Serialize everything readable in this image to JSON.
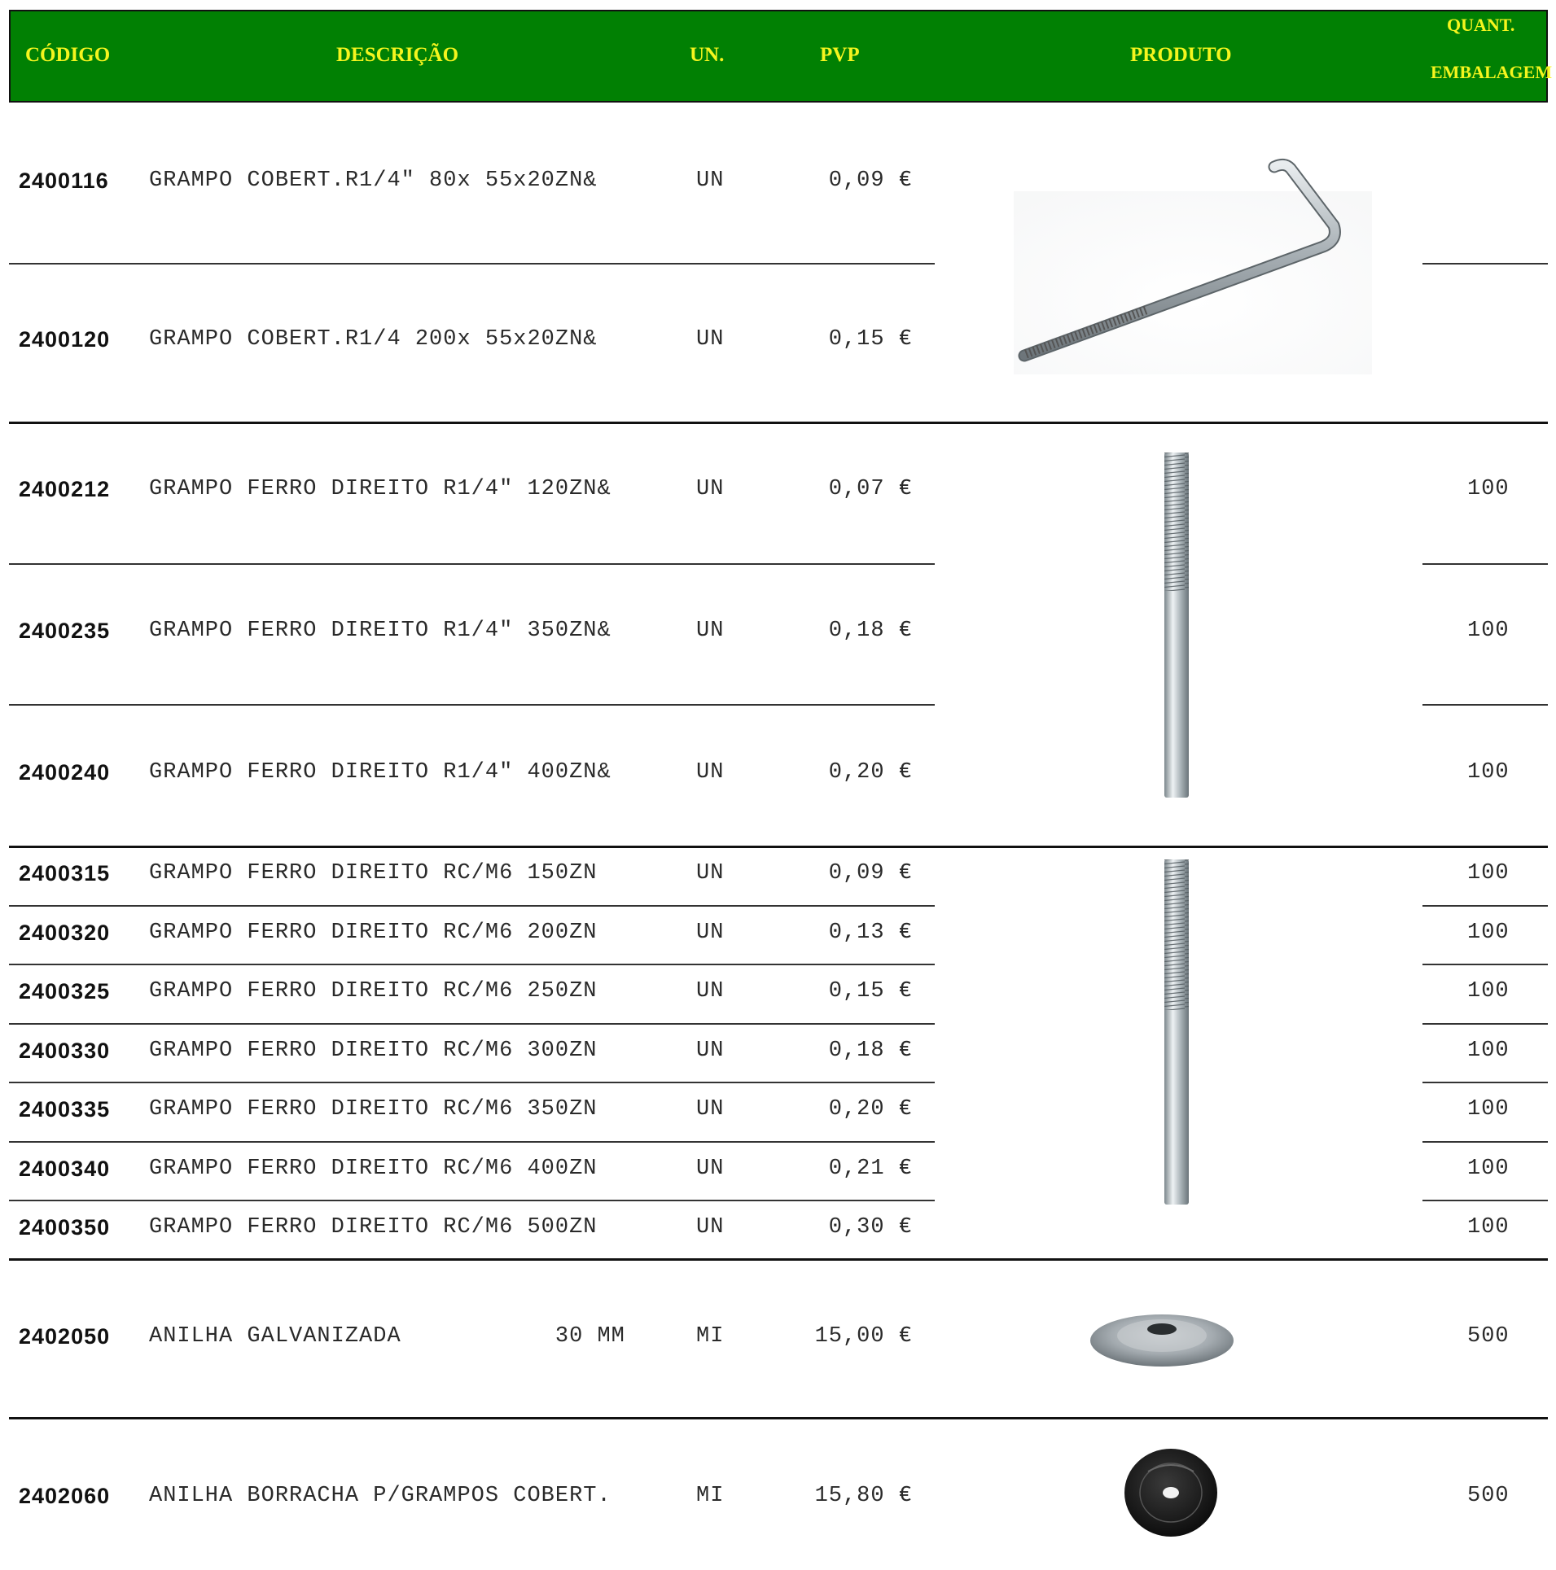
{
  "header": {
    "codigo": "CÓDIGO",
    "descricao": "DESCRIÇÃO",
    "un": "UN.",
    "pvp": "PVP",
    "produto": "PRODUTO",
    "quant_line1": "QUANT.",
    "quant_line2": "EMBALAGEM"
  },
  "rows": [
    {
      "code": "2400116",
      "desc": "GRAMPO COBERT.R1/4\"  80x 55x20ZN&",
      "un": "UN",
      "pvp": "0,09 €",
      "qty": ""
    },
    {
      "code": "2400120",
      "desc": "GRAMPO COBERT.R1/4  200x 55x20ZN&",
      "un": "UN",
      "pvp": "0,15 €",
      "qty": ""
    },
    {
      "code": "2400212",
      "desc": "GRAMPO FERRO DIREITO R1/4\" 120ZN&",
      "un": "UN",
      "pvp": "0,07 €",
      "qty": "100"
    },
    {
      "code": "2400235",
      "desc": "GRAMPO FERRO DIREITO R1/4\" 350ZN&",
      "un": "UN",
      "pvp": "0,18 €",
      "qty": "100"
    },
    {
      "code": "2400240",
      "desc": "GRAMPO FERRO DIREITO R1/4\" 400ZN&",
      "un": "UN",
      "pvp": "0,20 €",
      "qty": "100"
    },
    {
      "code": "2400315",
      "desc": "GRAMPO FERRO DIREITO RC/M6 150ZN",
      "un": "UN",
      "pvp": "0,09 €",
      "qty": "100"
    },
    {
      "code": "2400320",
      "desc": "GRAMPO FERRO DIREITO RC/M6 200ZN",
      "un": "UN",
      "pvp": "0,13 €",
      "qty": "100"
    },
    {
      "code": "2400325",
      "desc": "GRAMPO FERRO DIREITO RC/M6 250ZN",
      "un": "UN",
      "pvp": "0,15 €",
      "qty": "100"
    },
    {
      "code": "2400330",
      "desc": "GRAMPO FERRO DIREITO RC/M6 300ZN",
      "un": "UN",
      "pvp": "0,18 €",
      "qty": "100"
    },
    {
      "code": "2400335",
      "desc": "GRAMPO FERRO DIREITO RC/M6 350ZN",
      "un": "UN",
      "pvp": "0,20 €",
      "qty": "100"
    },
    {
      "code": "2400340",
      "desc": "GRAMPO FERRO DIREITO RC/M6 400ZN",
      "un": "UN",
      "pvp": "0,21 €",
      "qty": "100"
    },
    {
      "code": "2400350",
      "desc": "GRAMPO FERRO DIREITO RC/M6 500ZN",
      "un": "UN",
      "pvp": "0,30 €",
      "qty": "100"
    },
    {
      "code": "2402050",
      "desc": "ANILHA GALVANIZADA           30 MM",
      "un": "MI",
      "pvp": "15,00 €",
      "qty": "500"
    },
    {
      "code": "2402060",
      "desc": "ANILHA BORRACHA P/GRAMPOS COBERT.",
      "un": "MI",
      "pvp": "15,80 €",
      "qty": "500"
    }
  ],
  "images": {
    "l_hook": "l-shaped-roof-hook-image",
    "straight_rod_1": "straight-threaded-rod-image",
    "straight_rod_2": "straight-threaded-rod-image",
    "washer": "galvanized-washer-image",
    "rubber_washer": "rubber-washer-image"
  }
}
